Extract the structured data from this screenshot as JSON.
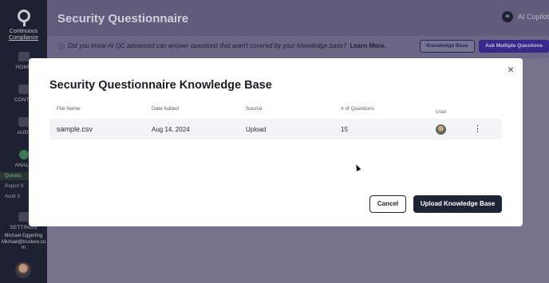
{
  "sidebar": {
    "logo_line1": "Continuous",
    "logo_line2": "Compliance",
    "items": [
      {
        "label": "HOME"
      },
      {
        "label": "CONTE"
      },
      {
        "label": "AUDI"
      },
      {
        "label": "ANALY"
      }
    ],
    "subitems": [
      {
        "label": "Questio"
      },
      {
        "label": "Report S"
      },
      {
        "label": "Audit S"
      }
    ],
    "settings_label": "SETTINGS",
    "user_name": "Michael Eggerling",
    "user_email_line1": "Michael@trustero.co",
    "user_email_line2": "m"
  },
  "header": {
    "title": "Security Questionnaire",
    "copilot_label": "AI Copilot",
    "copilot_icon_text": "AI"
  },
  "infobar": {
    "text": "Did you know AI QC advanced can answer questions that aren't covered by your knowledge base?",
    "link": "Learn More.",
    "knowledge_base_button": "Knowledge Base",
    "ask_multiple_button": "Ask Multiple Questions"
  },
  "modal": {
    "title": "Security Questionnaire Knowledge Base",
    "close_icon": "×",
    "columns": [
      "File Name",
      "Date Added",
      "Source",
      "# of Questions",
      "User"
    ],
    "rows": [
      {
        "file_name": "sample.csv",
        "date_added": "Aug 14, 2024",
        "source": "Upload",
        "questions": "15",
        "menu": "⋮"
      }
    ],
    "cancel_label": "Cancel",
    "upload_label": "Upload Knowledge Base"
  }
}
